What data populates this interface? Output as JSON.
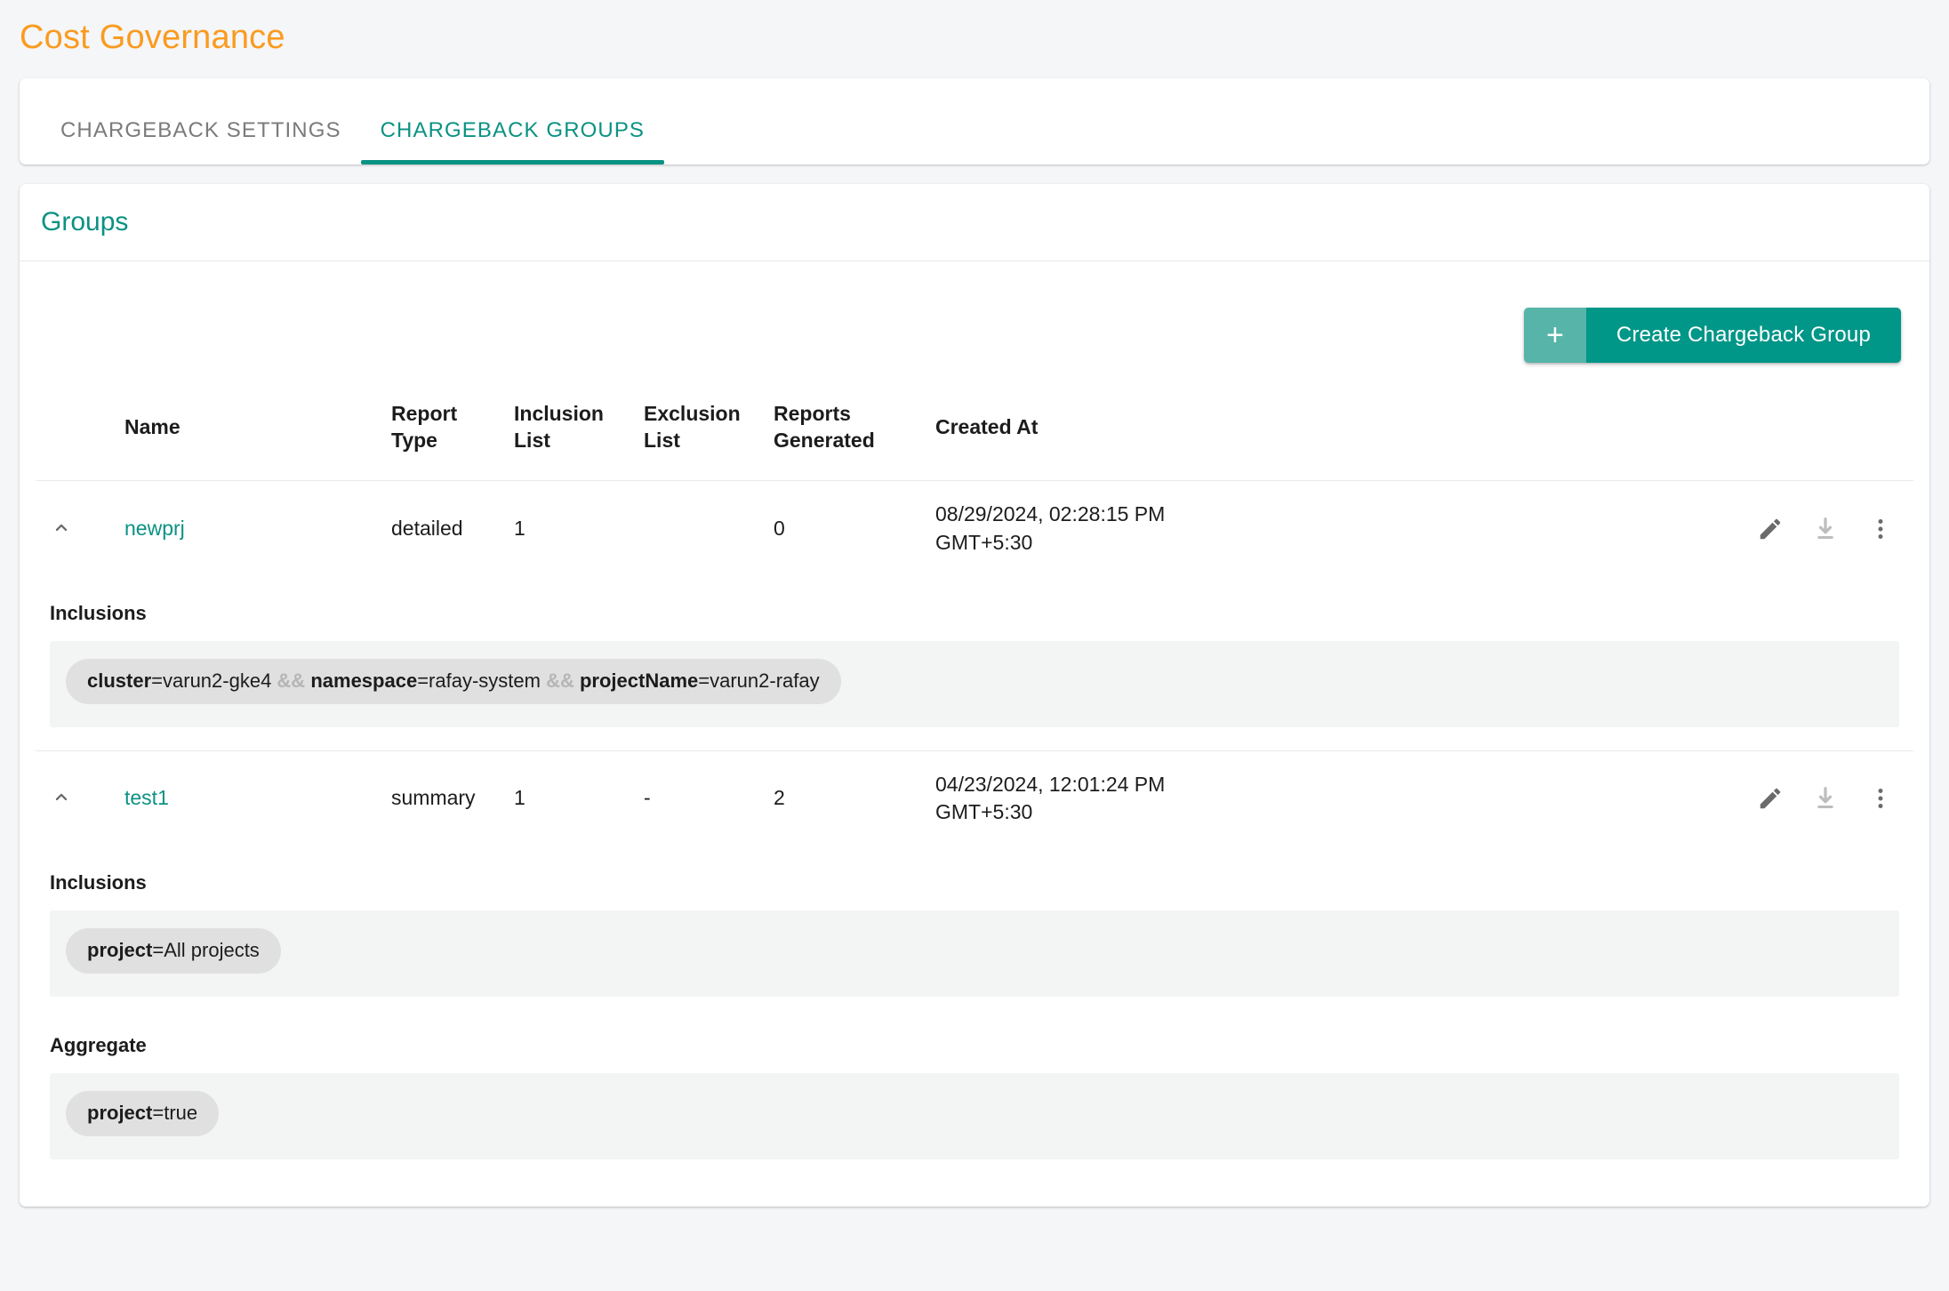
{
  "page": {
    "title": "Cost Governance",
    "title_color": "#fa9b20",
    "accent_color": "#009688",
    "background": "#f4f6f8"
  },
  "tabs": [
    {
      "label": "CHARGEBACK SETTINGS",
      "active": false
    },
    {
      "label": "CHARGEBACK GROUPS",
      "active": true
    }
  ],
  "groups_card": {
    "title": "Groups",
    "create_button": {
      "icon": "+",
      "label": "Create Chargeback Group"
    },
    "columns": [
      {
        "key": "name",
        "line1": "Name",
        "line2": ""
      },
      {
        "key": "rtype",
        "line1": "Report",
        "line2": "Type"
      },
      {
        "key": "incl",
        "line1": "Inclusion",
        "line2": "List"
      },
      {
        "key": "excl",
        "line1": "Exclusion",
        "line2": "List"
      },
      {
        "key": "reports",
        "line1": "Reports",
        "line2": "Generated"
      },
      {
        "key": "created",
        "line1": "Created At",
        "line2": ""
      }
    ],
    "rows": [
      {
        "name": "newprj",
        "report_type": "detailed",
        "inclusion_list": "1",
        "exclusion_list": "",
        "reports_generated": "0",
        "created_at_line1": "08/29/2024, 02:28:15 PM",
        "created_at_line2": "GMT+5:30",
        "expanded": true,
        "details": [
          {
            "label": "Inclusions",
            "chips": [
              {
                "parts": [
                  {
                    "t": "key",
                    "v": "cluster"
                  },
                  {
                    "t": "val",
                    "v": "=varun2-gke4 "
                  },
                  {
                    "t": "amp",
                    "v": "&&"
                  },
                  {
                    "t": "val",
                    "v": " "
                  },
                  {
                    "t": "key",
                    "v": "namespace"
                  },
                  {
                    "t": "val",
                    "v": "=rafay-system "
                  },
                  {
                    "t": "amp",
                    "v": "&&"
                  },
                  {
                    "t": "val",
                    "v": " "
                  },
                  {
                    "t": "key",
                    "v": "projectName"
                  },
                  {
                    "t": "val",
                    "v": "=varun2-rafay"
                  }
                ]
              }
            ]
          }
        ]
      },
      {
        "name": "test1",
        "report_type": "summary",
        "inclusion_list": "1",
        "exclusion_list": "-",
        "reports_generated": "2",
        "created_at_line1": "04/23/2024, 12:01:24 PM",
        "created_at_line2": "GMT+5:30",
        "expanded": true,
        "details": [
          {
            "label": "Inclusions",
            "chips": [
              {
                "parts": [
                  {
                    "t": "key",
                    "v": "project"
                  },
                  {
                    "t": "val",
                    "v": "=All projects"
                  }
                ]
              }
            ]
          },
          {
            "label": "Aggregate",
            "chips": [
              {
                "parts": [
                  {
                    "t": "key",
                    "v": "project"
                  },
                  {
                    "t": "val",
                    "v": "=true"
                  }
                ]
              }
            ]
          }
        ]
      }
    ],
    "row_actions": [
      {
        "name": "edit-icon",
        "title": "Edit"
      },
      {
        "name": "download-icon",
        "title": "Download"
      },
      {
        "name": "more-icon",
        "title": "More options"
      }
    ]
  }
}
